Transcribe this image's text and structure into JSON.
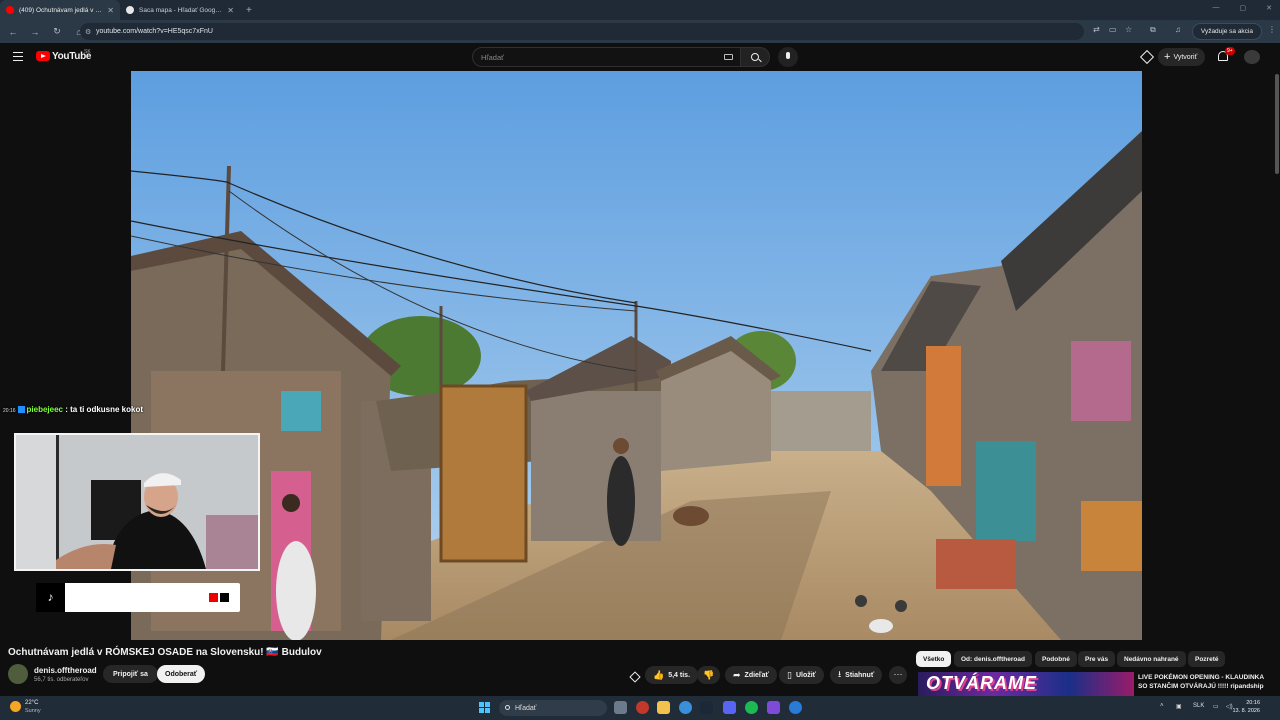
{
  "browser": {
    "tabs": [
      {
        "title": "(409) Ochutnávam jedlá v RÓM",
        "active": true
      },
      {
        "title": "Saca mapa - Hľadať Googlom",
        "active": false
      }
    ],
    "new_tab": "+",
    "url": "youtube.com/watch?v=HE5qsc7xFnU",
    "action_label": "Vyžaduje sa akcia"
  },
  "youtube": {
    "logo_text": "YouTube",
    "country_code": "SK",
    "search_placeholder": "Hľadať",
    "create_label": "Vytvoriť",
    "notification_count": "9+"
  },
  "overlay": {
    "chat_time": "20:16",
    "chat_user": "piebejeec",
    "chat_text": ": ta ti odkusne kokot"
  },
  "video": {
    "title": "Ochutnávam jedlá v RÓMSKEJ OSADE na Slovensku! 🇸🇰 Budulov",
    "channel_name": "denis.offtheroad",
    "subscribers": "56,7 tis. odberateľov",
    "join_label": "Pripojiť sa",
    "subscribe_label": "Odoberať",
    "like_count": "5,4 tis.",
    "share_label": "Zdieľať",
    "save_label": "Uložiť",
    "download_label": "Stiahnuť",
    "more_label": "···"
  },
  "recommendations": {
    "chips": [
      "Všetko",
      "Od: denis.offtheroad",
      "Podobné",
      "Pre vás",
      "Nedávno nahrané",
      "Pozreté"
    ],
    "first_title": "LIVE POKÉMON OPENING - KLAUDINKA SO STANČIM OTVÁRAJÚ !!!!! ripandship",
    "first_thumb_text": "OTVÁRAME"
  },
  "taskbar": {
    "weather_temp": "22°C",
    "weather_desc": "Sunny",
    "search_label": "Hľadať",
    "lang": "SLK",
    "time": "20:16",
    "date": "13. 8. 2026"
  },
  "colors": {
    "yt_red": "#ff0000",
    "background": "#0f0f0f",
    "chat_user": "#7fff3a"
  }
}
